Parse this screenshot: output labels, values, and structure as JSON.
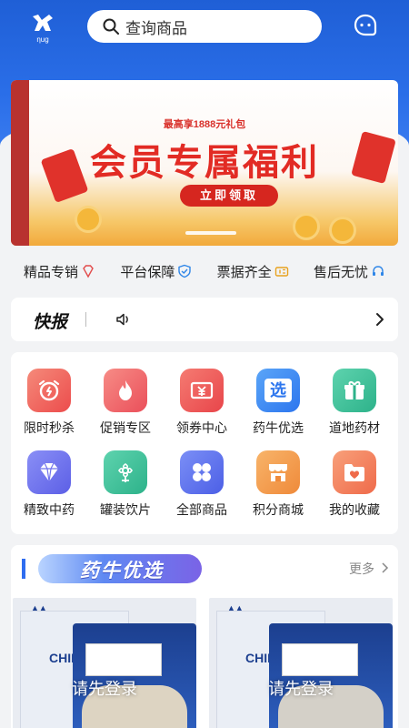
{
  "header": {
    "logo_text": "ηug",
    "search_placeholder": "查询商品"
  },
  "banner": {
    "subtitle": "最高享1888元礼包",
    "title": "会员专属福利",
    "button": "立即领取"
  },
  "features": [
    {
      "label": "精品专销",
      "icon": "diamond-icon"
    },
    {
      "label": "平台保障",
      "icon": "shield-icon"
    },
    {
      "label": "票据齐全",
      "icon": "ticket-icon"
    },
    {
      "label": "售后无忧",
      "icon": "headset-icon"
    }
  ],
  "news": {
    "title": "快报"
  },
  "categories": [
    {
      "label": "限时秒杀",
      "icon": "alarm-clock-icon",
      "color": "#f0615a"
    },
    {
      "label": "促销专区",
      "icon": "flame-icon",
      "color": "#f2686a"
    },
    {
      "label": "领券中心",
      "icon": "coupon-icon",
      "color": "#f05a5a"
    },
    {
      "label": "药牛优选",
      "icon": "select-icon",
      "color": "#3b86f2",
      "glyph": "选"
    },
    {
      "label": "道地药材",
      "icon": "gift-icon",
      "color": "#3fc29a"
    },
    {
      "label": "精致中药",
      "icon": "gem-icon",
      "color": "#6d6ff0"
    },
    {
      "label": "罐装饮片",
      "icon": "flower-icon",
      "color": "#3fbf96"
    },
    {
      "label": "全部商品",
      "icon": "grid-icon",
      "color": "#5b6cf0"
    },
    {
      "label": "积分商城",
      "icon": "shop-icon",
      "color": "#f59a4a"
    },
    {
      "label": "我的收藏",
      "icon": "heart-folder-icon",
      "color": "#f2765a"
    }
  ],
  "section": {
    "title": "药牛优选",
    "more": "更多"
  },
  "products": [
    {
      "login_text": "请先登录",
      "brand_text": "CHINESE MEDICIN"
    },
    {
      "login_text": "请先登录",
      "brand_text": "CHINESE MEDICIN"
    }
  ],
  "colors": {
    "primary": "#2a6ee8",
    "banner_red": "#e22b24"
  }
}
